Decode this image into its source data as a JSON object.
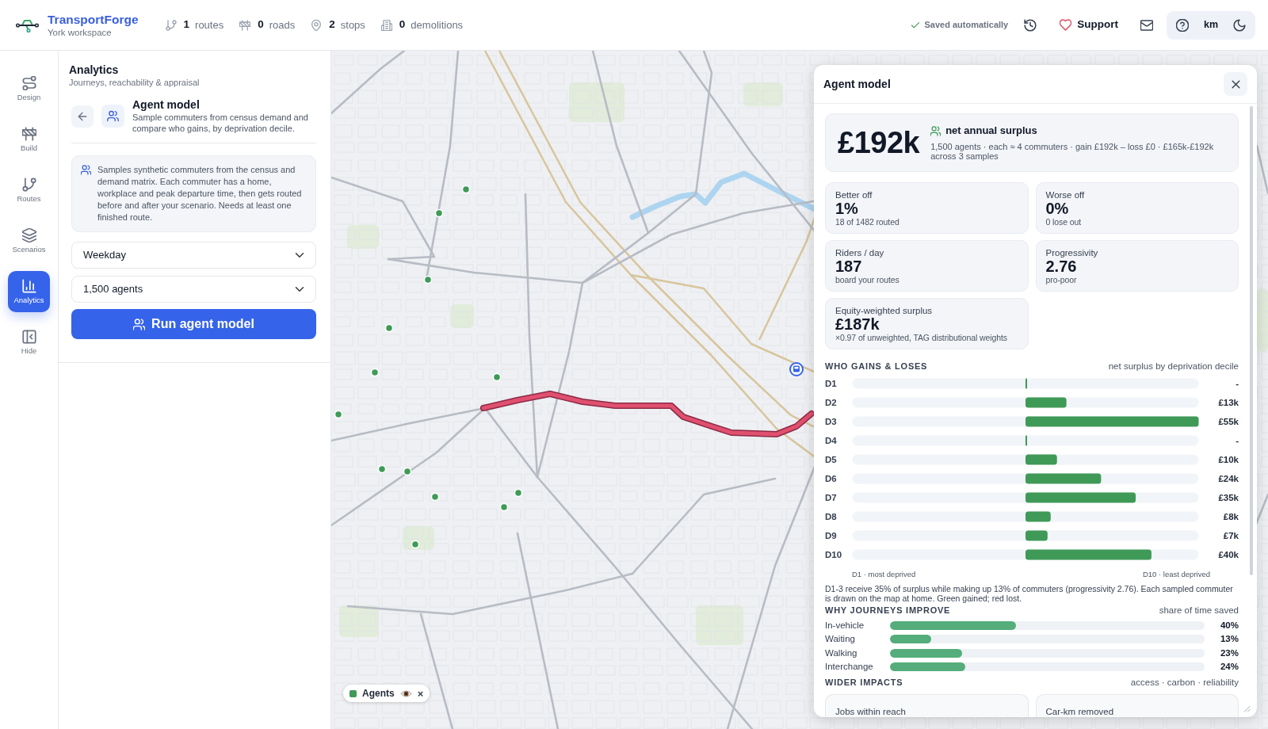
{
  "app": {
    "name": "TransportForge",
    "workspace": "York workspace"
  },
  "stats": [
    {
      "kind": "routes",
      "count": "1",
      "label": "routes"
    },
    {
      "kind": "roads",
      "count": "0",
      "label": "roads"
    },
    {
      "kind": "stops",
      "count": "2",
      "label": "stops"
    },
    {
      "kind": "demolitions",
      "count": "0",
      "label": "demolitions"
    }
  ],
  "toolbar": {
    "save_status": "Saved automatically",
    "support": "Support",
    "units": "km"
  },
  "rail": [
    {
      "kind": "design",
      "label": "Design",
      "selected": false
    },
    {
      "kind": "build",
      "label": "Build",
      "selected": false
    },
    {
      "kind": "routes",
      "label": "Routes",
      "selected": false
    },
    {
      "kind": "scenarios",
      "label": "Scenarios",
      "selected": false
    },
    {
      "kind": "analytics",
      "label": "Analytics",
      "selected": true
    },
    {
      "kind": "hide",
      "label": "Hide",
      "selected": false
    }
  ],
  "panel": {
    "title": "Analytics",
    "subtitle": "Journeys, reachability & appraisal",
    "tool": {
      "title": "Agent model",
      "description": "Sample commuters from census demand and compare who gains, by deprivation decile."
    },
    "info": "Samples synthetic commuters from the census and demand matrix. Each commuter has a home, workplace and peak departure time, then gets routed before and after your scenario. Needs at least one finished route.",
    "selects": [
      {
        "value": "Weekday"
      },
      {
        "value": "1,500 agents"
      }
    ],
    "run_button": "Run agent model"
  },
  "map": {
    "layers": [
      {
        "label": "Agents",
        "remove": "×"
      }
    ]
  },
  "results": {
    "title": "Agent model",
    "headline": {
      "value": "£192k",
      "label": "net annual surplus",
      "detail": "1,500 agents · each ≈ 4 commuters · gain £192k – loss £0 · £165k-£192k across 3 samples"
    },
    "stats": [
      {
        "label": "Better off",
        "value": "1%",
        "note": "18 of 1482 routed"
      },
      {
        "label": "Worse off",
        "value": "0%",
        "note": "0 lose out"
      },
      {
        "label": "Riders / day",
        "value": "187",
        "note": "board your routes"
      },
      {
        "label": "Progressivity",
        "value": "2.76",
        "note": "pro-poor"
      },
      {
        "label": "Equity-weighted surplus",
        "value": "£187k",
        "note": "×0.97 of unweighted, TAG distributional weights"
      }
    ],
    "who_gains": {
      "heading": "WHO GAINS & LOSES",
      "caption": "net surplus by deprivation decile",
      "chart_data": {
        "type": "bar",
        "orientation": "horizontal",
        "categories": [
          "D1",
          "D2",
          "D3",
          "D4",
          "D5",
          "D6",
          "D7",
          "D8",
          "D9",
          "D10"
        ],
        "values": [
          0,
          13,
          55,
          0,
          10,
          24,
          35,
          8,
          7,
          40
        ],
        "value_labels": [
          "-",
          "£13k",
          "£55k",
          "-",
          "£10k",
          "£24k",
          "£35k",
          "£8k",
          "£7k",
          "£40k"
        ]
      },
      "axis_notes": [
        "D1 · most deprived",
        "D10 · least deprived"
      ],
      "summary": "D1-3 receive 35% of surplus while making up 13% of commuters (progressivity 2.76). Each sampled commuter is drawn on the map at home. Green gained; red lost."
    },
    "why_improve": {
      "heading": "WHY JOURNEYS IMPROVE",
      "caption": "share of time saved",
      "rows": [
        {
          "label": "In-vehicle",
          "level": 0.4,
          "reading": "40%"
        },
        {
          "label": "Waiting",
          "level": 0.13,
          "reading": "13%"
        },
        {
          "label": "Walking",
          "level": 0.23,
          "reading": "23%"
        },
        {
          "label": "Interchange",
          "level": 0.24,
          "reading": "24%"
        }
      ]
    },
    "wider": {
      "heading": "WIDER IMPACTS",
      "caption": "access · carbon · reliability",
      "cards": [
        {
          "label": "Jobs within reach"
        },
        {
          "label": "Car-km removed"
        }
      ]
    }
  }
}
